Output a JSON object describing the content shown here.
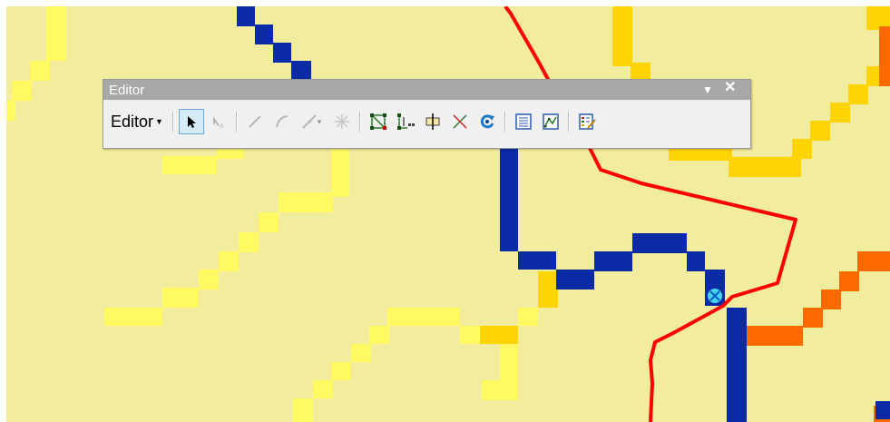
{
  "window": {
    "title": "Editor"
  },
  "toolbar": {
    "menu_label": "Editor",
    "buttons": [
      {
        "icon": "edit-tool-arrow-icon",
        "enabled": true,
        "active": true
      },
      {
        "icon": "edit-annotation-tool-icon",
        "enabled": false
      },
      {
        "icon": "straight-segment-icon",
        "enabled": false
      },
      {
        "icon": "end-point-arc-icon",
        "enabled": false
      },
      {
        "icon": "trace-tool-icon",
        "enabled": false,
        "has_dropdown": true
      },
      {
        "icon": "point-tool-icon",
        "enabled": false
      },
      {
        "icon": "edit-vertices-icon",
        "enabled": true
      },
      {
        "icon": "reshape-feature-icon",
        "enabled": true
      },
      {
        "icon": "cut-polygons-icon",
        "enabled": true
      },
      {
        "icon": "split-tool-icon",
        "enabled": true
      },
      {
        "icon": "rotate-tool-icon",
        "enabled": true
      },
      {
        "icon": "attributes-icon",
        "enabled": true
      },
      {
        "icon": "sketch-properties-icon",
        "enabled": true
      },
      {
        "icon": "create-features-icon",
        "enabled": true
      }
    ]
  },
  "map": {
    "background_color": "#f2ec9e",
    "colors": {
      "light_yellow": "#fffa62",
      "yellow": "#fff23a",
      "gold": "#ffd400",
      "orange": "#ff6a00",
      "navy": "#0a2aa6",
      "red_line": "#ff0000",
      "point": "#44d4f0"
    }
  }
}
